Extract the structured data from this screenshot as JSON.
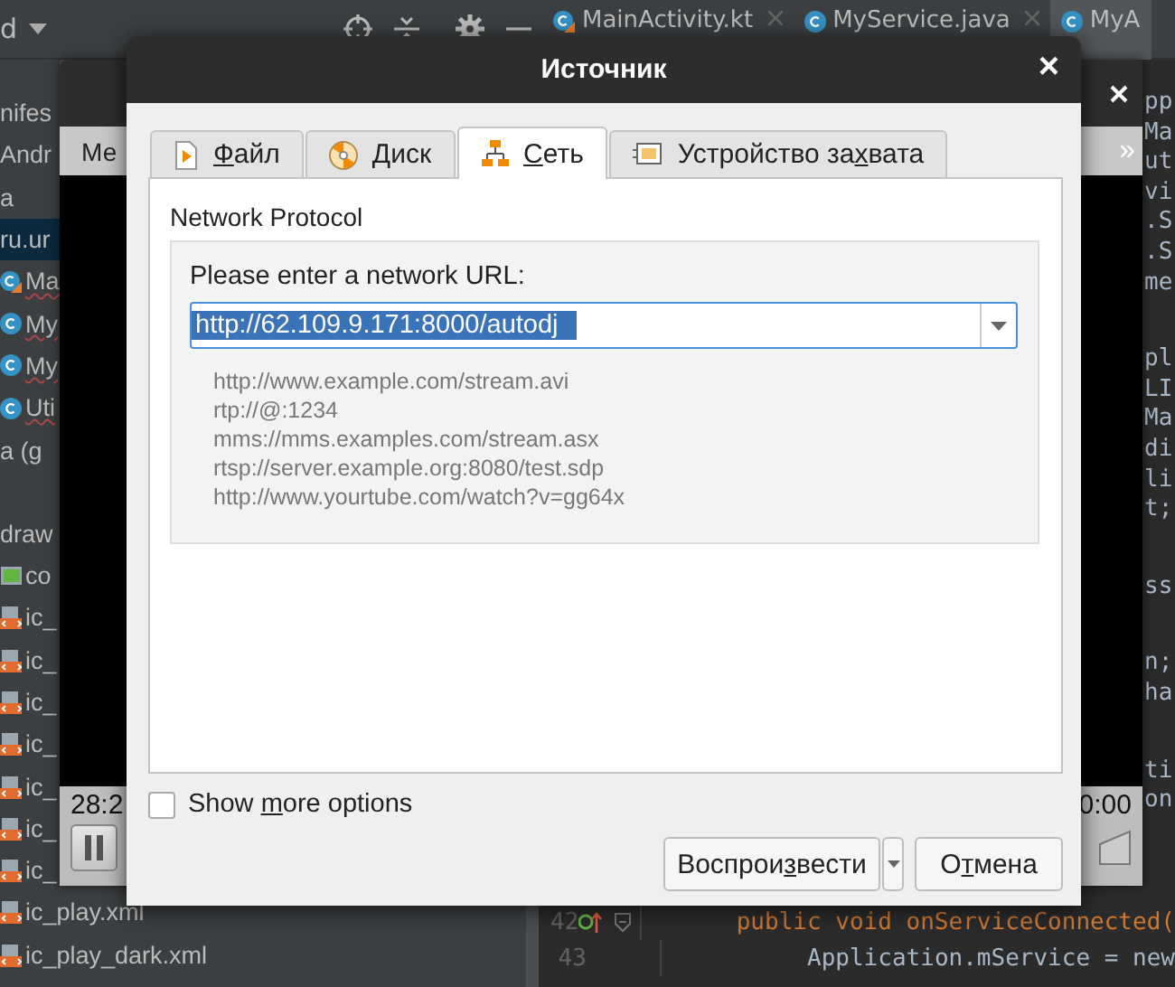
{
  "ide": {
    "project_selector": "d",
    "editor_tabs": [
      {
        "label": "MainActivity.kt",
        "kind": "kotlin",
        "selected": false
      },
      {
        "label": "MyService.java",
        "kind": "java",
        "selected": false
      },
      {
        "label": "MyA",
        "kind": "java",
        "selected": true
      }
    ],
    "project_tree": [
      {
        "label": "nifes",
        "kind": "folder",
        "selected": false
      },
      {
        "label": "Andr",
        "kind": "folder",
        "selected": false
      },
      {
        "label": "a",
        "kind": "folder",
        "selected": false
      },
      {
        "label": "ru.ur",
        "kind": "folder",
        "selected": true
      },
      {
        "label": "Ma",
        "kind": "kotlin",
        "selected": false
      },
      {
        "label": "My",
        "kind": "class",
        "selected": false
      },
      {
        "label": "My",
        "kind": "class",
        "selected": false
      },
      {
        "label": "Uti",
        "kind": "class",
        "selected": false
      },
      {
        "label": "a (g",
        "kind": "folder",
        "selected": false
      },
      {
        "label": "draw",
        "kind": "gapfolder",
        "selected": false
      },
      {
        "label": "co",
        "kind": "image",
        "selected": false
      },
      {
        "label": "ic_",
        "kind": "xml",
        "selected": false
      },
      {
        "label": "ic_",
        "kind": "xml",
        "selected": false
      },
      {
        "label": "ic_",
        "kind": "xml",
        "selected": false
      },
      {
        "label": "ic_",
        "kind": "xml",
        "selected": false
      },
      {
        "label": "ic_",
        "kind": "xml",
        "selected": false
      },
      {
        "label": "ic_",
        "kind": "xml",
        "selected": false
      },
      {
        "label": "ic_",
        "kind": "xml",
        "selected": false
      },
      {
        "label": "ic_play.xml",
        "kind": "xml",
        "selected": false
      },
      {
        "label": "ic_play_dark.xml",
        "kind": "xml",
        "selected": false
      }
    ],
    "code_fragments": [
      [
        "pp",
        "Ma",
        "ut",
        "vi",
        ".S",
        ".S",
        "me"
      ],
      [
        "pl",
        "LI",
        "Ma",
        "di",
        "li",
        "t;"
      ],
      [
        "ss"
      ],
      [
        "n;",
        "ha"
      ],
      [
        "ti",
        "on"
      ]
    ],
    "code_lines": [
      {
        "number": "42",
        "text": "public void onServiceConnected("
      },
      {
        "number": "43",
        "text": "Application.mService = new"
      }
    ]
  },
  "player": {
    "menu_label": "Ме",
    "more": "»",
    "time_elapsed": "28:2",
    "time_total": "0:00"
  },
  "dialog": {
    "title": "Источник",
    "close": "×",
    "tabs": [
      {
        "key": "Ф",
        "after": "айл",
        "kind": "file",
        "selected": false
      },
      {
        "key": "Д",
        "after": "иск",
        "kind": "disc",
        "selected": false
      },
      {
        "key": "С",
        "after": "еть",
        "kind": "network",
        "selected": true
      },
      {
        "before": "Устройство за",
        "key": "х",
        "after": "вата",
        "kind": "capture",
        "selected": false
      }
    ],
    "section_title": "Network Protocol",
    "url_label": "Please enter a network URL:",
    "url_value": "http://62.109.9.171:8000/autodj",
    "examples": [
      "http://www.example.com/stream.avi",
      "rtp://@:1234",
      "mms://mms.examples.com/stream.asx",
      "rtsp://server.example.org:8080/test.sdp",
      "http://www.yourtube.com/watch?v=gg64x"
    ],
    "show_more": {
      "before": "Show ",
      "key": "m",
      "after": "ore options",
      "checked": false
    },
    "buttons": [
      {
        "before": "Воспрои",
        "key": "з",
        "after": "вести",
        "kind": "split"
      },
      {
        "before": "О",
        "key": "т",
        "after": "мена",
        "kind": "plain"
      }
    ]
  }
}
